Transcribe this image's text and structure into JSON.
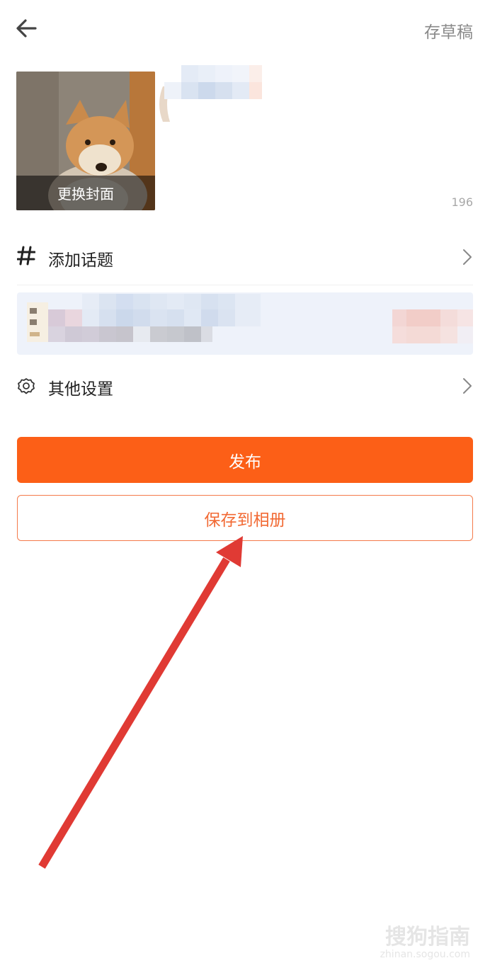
{
  "header": {
    "back_icon": "arrow-left-icon",
    "draft_label": "存草稿"
  },
  "cover": {
    "change_label": "更换封面"
  },
  "description": {
    "char_count": "196"
  },
  "topic": {
    "icon": "hashtag-icon",
    "label": "添加话题"
  },
  "settings": {
    "icon": "gear-icon",
    "label": "其他设置"
  },
  "actions": {
    "publish_label": "发布",
    "save_label": "保存到相册"
  },
  "watermark": {
    "brand": "搜狗指南",
    "url": "zhinan.sogou.com"
  },
  "colors": {
    "primary": "#fc5f17",
    "secondary_text": "#f26a34",
    "annotation_arrow": "#e03a34"
  }
}
